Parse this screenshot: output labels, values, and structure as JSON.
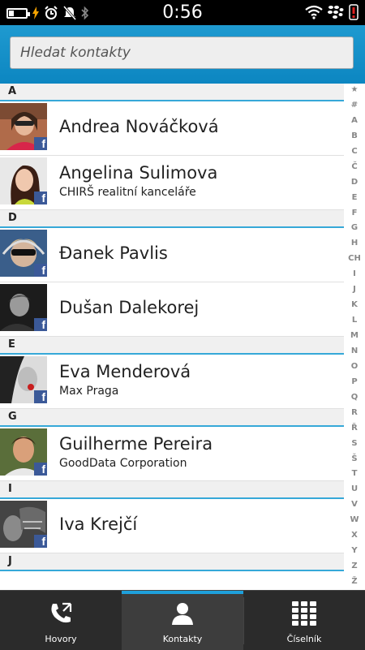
{
  "status_bar": {
    "time": "0:56"
  },
  "search": {
    "placeholder": "Hledat kontakty"
  },
  "sections": [
    {
      "letter": "A",
      "contacts": [
        {
          "name": "Andrea Nováčková",
          "company": ""
        },
        {
          "name": "Angelina Sulimova",
          "company": "CHIRŠ realitní kanceláře"
        }
      ]
    },
    {
      "letter": "D",
      "contacts": [
        {
          "name": "Đanek Pavlis",
          "company": ""
        },
        {
          "name": "Dušan Dalekorej",
          "company": ""
        }
      ]
    },
    {
      "letter": "E",
      "contacts": [
        {
          "name": "Eva Menderová",
          "company": "Max Praga"
        }
      ]
    },
    {
      "letter": "G",
      "contacts": [
        {
          "name": "Guilherme Pereira",
          "company": "GoodData Corporation"
        }
      ]
    },
    {
      "letter": "I",
      "contacts": [
        {
          "name": "Iva Krejčí",
          "company": ""
        }
      ]
    },
    {
      "letter": "J",
      "contacts": []
    }
  ],
  "alphabet_index": [
    "★",
    "#",
    "A",
    "B",
    "C",
    "Č",
    "D",
    "E",
    "F",
    "G",
    "H",
    "CH",
    "I",
    "J",
    "K",
    "L",
    "M",
    "N",
    "O",
    "P",
    "Q",
    "R",
    "Ř",
    "S",
    "Š",
    "T",
    "U",
    "V",
    "W",
    "X",
    "Y",
    "Z",
    "Ž"
  ],
  "tabs": [
    {
      "label": "Hovory",
      "icon": "phone-calls-icon"
    },
    {
      "label": "Kontakty",
      "icon": "contact-person-icon",
      "active": true
    },
    {
      "label": "Číselník",
      "icon": "dialpad-icon"
    }
  ],
  "colors": {
    "accent": "#1ea0dc",
    "header": "#1491cb",
    "facebook": "#3b5998"
  }
}
